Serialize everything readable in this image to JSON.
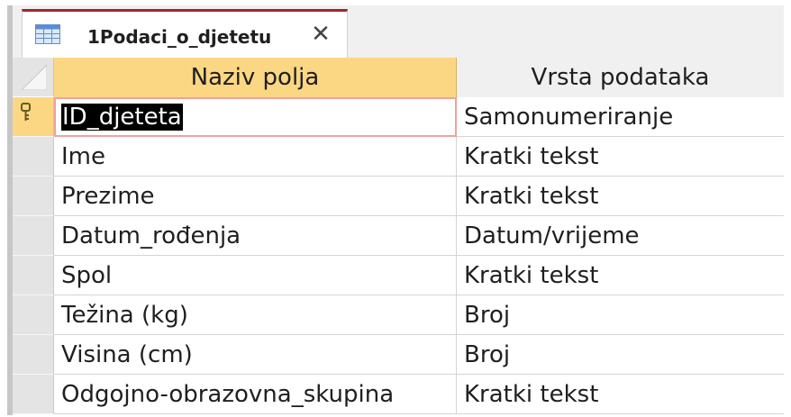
{
  "tab": {
    "title": "1Podaci_o_djetetu",
    "close_glyph": "✕",
    "icon": "table-icon"
  },
  "grid": {
    "columns": [
      "Naziv polja",
      "Vrsta podataka"
    ],
    "rows": [
      {
        "name": "ID_djeteta",
        "type": "Samonumeriranje",
        "primary_key": true,
        "selected": true
      },
      {
        "name": "Ime",
        "type": "Kratki tekst"
      },
      {
        "name": "Prezime",
        "type": "Kratki tekst"
      },
      {
        "name": "Datum_rođenja",
        "type": "Datum/vrijeme"
      },
      {
        "name": "Spol",
        "type": "Kratki tekst"
      },
      {
        "name": "Težina (kg)",
        "type": "Broj"
      },
      {
        "name": "Visina (cm)",
        "type": "Broj"
      },
      {
        "name": "Odgojno-obrazovna_skupina",
        "type": "Kratki tekst"
      }
    ]
  },
  "colors": {
    "header_highlight": "#fbd784",
    "tab_accent": "#a4262c",
    "active_cell_border": "#f0a0a0"
  }
}
